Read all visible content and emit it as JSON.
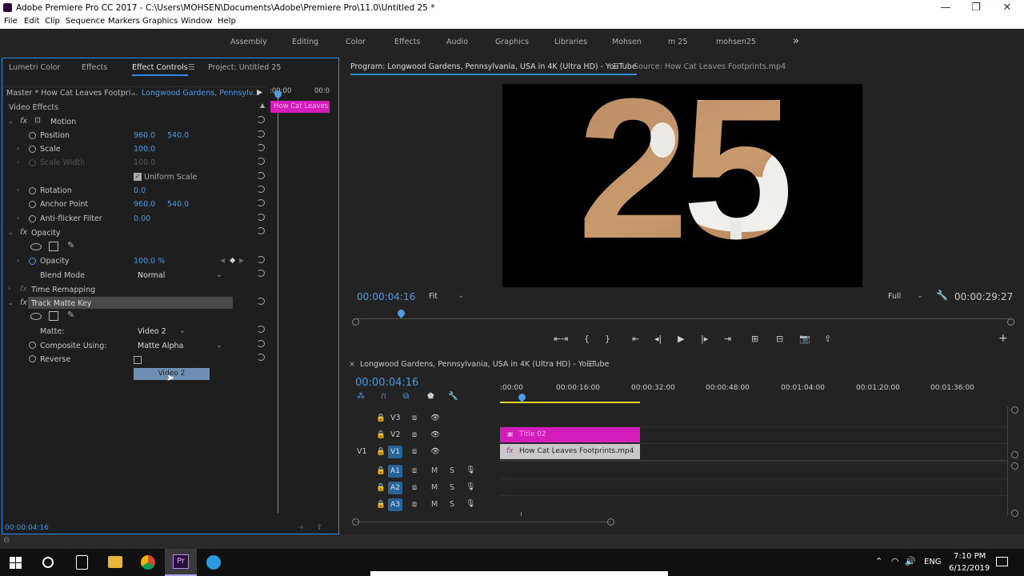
{
  "window": {
    "title": "Adobe Premiere Pro CC 2017 - C:\\Users\\MOHSEN\\Documents\\Adobe\\Premiere Pro\\11.0\\Untitled 25 *",
    "min": "—",
    "max": "❐",
    "close": "✕"
  },
  "menu": [
    "File",
    "Edit",
    "Clip",
    "Sequence",
    "Markers",
    "Graphics",
    "Window",
    "Help"
  ],
  "workspaces": [
    "Assembly",
    "Editing",
    "Color",
    "Effects",
    "Audio",
    "Graphics",
    "Libraries",
    "Mohsen",
    "m 25",
    "mohsen25"
  ],
  "workspace_more": "»",
  "left_panel": {
    "tabs": [
      "Lumetri Color",
      "Effects",
      "Effect Controls",
      "Project: Untitled 25"
    ],
    "tab_menu": "☰",
    "master": "Master * How Cat Leaves Footpri...",
    "sequence": "Longwood Gardens, Pennsylv...",
    "mini_times": [
      ":00:00",
      "00:0"
    ],
    "mini_clip": "How Cat Leaves",
    "video_effects": "Video Effects",
    "motion": "Motion",
    "position": {
      "label": "Position",
      "x": "960.0",
      "y": "540.0"
    },
    "scale": {
      "label": "Scale",
      "value": "100.0"
    },
    "scale_width": {
      "label": "Scale Width",
      "value": "100.0"
    },
    "uniform": "Uniform Scale",
    "rotation": {
      "label": "Rotation",
      "value": "0.0"
    },
    "anchor": {
      "label": "Anchor Point",
      "x": "960.0",
      "y": "540.0"
    },
    "antiflicker": {
      "label": "Anti-flicker Filter",
      "value": "0.00"
    },
    "opacity_group": "Opacity",
    "opacity": {
      "label": "Opacity",
      "value": "100.0 %"
    },
    "blend": {
      "label": "Blend Mode",
      "value": "Normal"
    },
    "time_remap": "Time Remapping",
    "track_matte": "Track Matte Key",
    "matte": {
      "label": "Matte:",
      "value": "Video 2"
    },
    "composite": {
      "label": "Composite Using:",
      "value": "Matte Alpha"
    },
    "reverse": {
      "label": "Reverse"
    },
    "dropdown_hover": "Video 2",
    "fx": "fx",
    "timecode": "00:00:04:16"
  },
  "program": {
    "tab": "Program: Longwood Gardens, Pennsylvania, USA in 4K (Ultra HD) - YouTube",
    "tab_menu": "☰",
    "source_tab": "Source: How Cat Leaves Footprints.mp4",
    "video_text": "25",
    "timecode": "00:00:04:16",
    "fit": "Fit",
    "quality": "Full",
    "duration": "00:00:29:27",
    "playhead_fraction": 0.07,
    "transport": [
      "⇤⇥",
      "{",
      "}",
      "⇤",
      "◂|",
      "▶",
      "|▸",
      "⇥",
      "⊞",
      "⊟",
      "📷",
      "⇪"
    ],
    "add": "+"
  },
  "timeline": {
    "close": "×",
    "name": "Longwood Gardens, Pennsylvania, USA in 4K (Ultra HD) - YouTube",
    "menu": "☰",
    "timecode": "00:00:04:16",
    "ruler": [
      ":00:00",
      "00:00:16:00",
      "00:00:32:00",
      "00:00:48:00",
      "00:01:04:00",
      "00:01:20:00",
      "00:01:36:00"
    ],
    "video_tracks": [
      "V3",
      "V2",
      "V1"
    ],
    "audio_tracks": [
      "A1",
      "A2",
      "A3"
    ],
    "source_patch": "V1",
    "clip_v2": "Title 02",
    "clip_v1": "How Cat Leaves Footprints.mp4",
    "fx": "fx",
    "m": "M",
    "s": "S"
  },
  "taskbar": {
    "lang": "ENG",
    "time": "7:10 PM",
    "date": "6/12/2019"
  },
  "colors": {
    "accent": "#2d8ceb",
    "timecode": "#4e9be6",
    "title_clip": "#d41dbb",
    "video_clip": "#c8c8c8"
  }
}
